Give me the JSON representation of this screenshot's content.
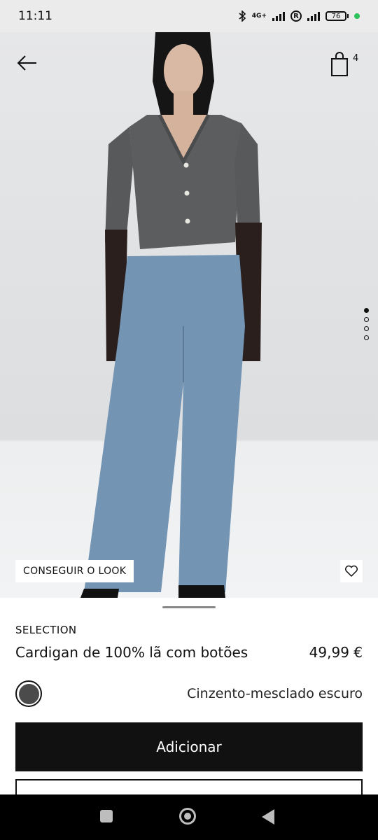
{
  "status_bar": {
    "time": "11:11",
    "network": "4G+",
    "battery": "76",
    "icons": [
      "bluetooth-icon",
      "signal-icon",
      "registered-icon",
      "wifi-signal-icon",
      "battery-icon",
      "active-dot-icon"
    ]
  },
  "header": {
    "back_icon": "arrow-left-icon",
    "bag_icon": "shopping-bag-icon",
    "bag_count": "4"
  },
  "gallery": {
    "image_count": 4,
    "active_index": 0,
    "look_button": "CONSEGUIR O LOOK",
    "favorite_icon": "heart-icon"
  },
  "product": {
    "brand_label": "SELECTION",
    "name": "Cardigan de 100% lã com botões",
    "price": "49,99 €",
    "color_name": "Cinzento-mesclado escuro",
    "swatch_color": "#4b4b4b"
  },
  "actions": {
    "add_label": "Adicionar"
  },
  "colors": {
    "primary": "#111111",
    "hero_bg": "#dcdee0"
  }
}
